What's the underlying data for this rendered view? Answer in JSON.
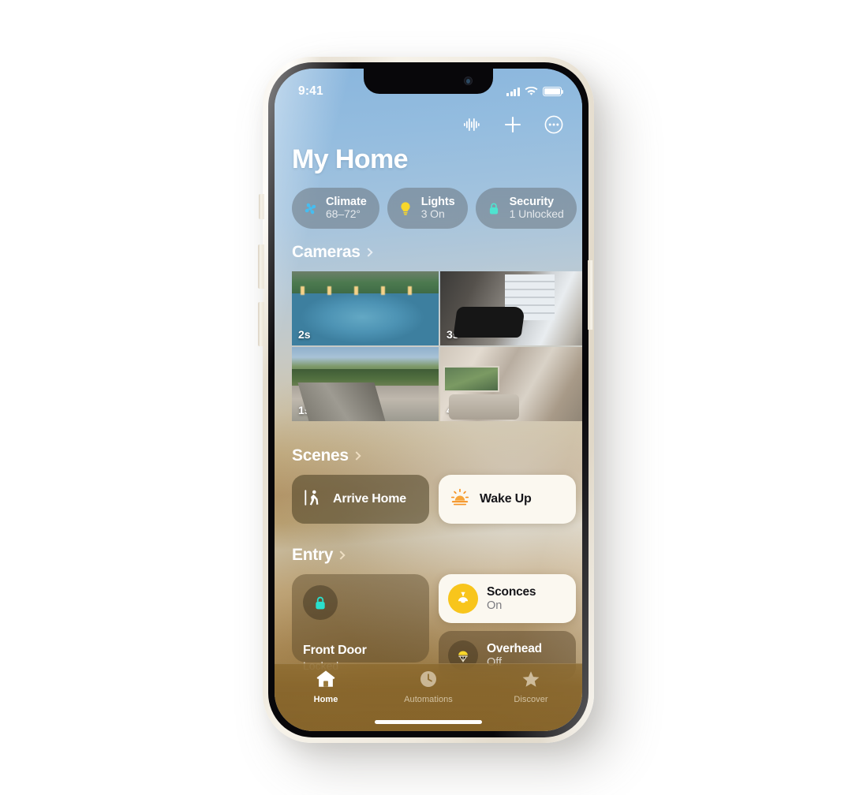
{
  "status_bar": {
    "time": "9:41",
    "cellular_icon": "signal-bars-icon",
    "wifi_icon": "wifi-icon",
    "battery_icon": "battery-full-icon"
  },
  "header": {
    "title": "My Home",
    "actions": [
      {
        "name": "siri-waveform-icon",
        "label": "Siri"
      },
      {
        "name": "add-icon",
        "label": "Add"
      },
      {
        "name": "more-options-icon",
        "label": "More"
      }
    ]
  },
  "status_pills": [
    {
      "icon": "fan-icon",
      "title": "Climate",
      "subtitle": "68–72°",
      "color": "#46bdf0"
    },
    {
      "icon": "bulb-icon",
      "title": "Lights",
      "subtitle": "3 On",
      "color": "#f8d72b"
    },
    {
      "icon": "lock-icon",
      "title": "Security",
      "subtitle": "1 Unlocked",
      "color": "#4fe3d0"
    }
  ],
  "sections": {
    "cameras": {
      "title": "Cameras",
      "chevron": "chevron-right-icon"
    },
    "scenes": {
      "title": "Scenes",
      "chevron": "chevron-right-icon"
    },
    "entry": {
      "title": "Entry",
      "chevron": "chevron-right-icon"
    }
  },
  "cameras": [
    {
      "name": "camera-pool",
      "timestamp": "2s"
    },
    {
      "name": "camera-garage",
      "timestamp": "3s"
    },
    {
      "name": "camera-driveway",
      "timestamp": "1s"
    },
    {
      "name": "camera-livingroom",
      "timestamp": "4s"
    }
  ],
  "scenes": [
    {
      "name": "scene-arrive-home",
      "label": "Arrive Home",
      "icon": "person-walking-door-icon",
      "state": "off"
    },
    {
      "name": "scene-wake-up",
      "label": "Wake Up",
      "icon": "sunrise-icon",
      "state": "on"
    }
  ],
  "entry": {
    "front_door": {
      "label": "Front Door",
      "subtitle": "Locked",
      "icon": "lock-icon"
    },
    "accessories": [
      {
        "name": "sconces",
        "title": "Sconces",
        "state": "On",
        "icon": "sconce-lamp-icon"
      },
      {
        "name": "overhead",
        "title": "Overhead",
        "state": "Off",
        "icon": "ceiling-light-icon"
      }
    ]
  },
  "tab_bar": [
    {
      "name": "tab-home",
      "label": "Home",
      "icon": "house-icon",
      "active": true
    },
    {
      "name": "tab-automations",
      "label": "Automations",
      "icon": "clock-icon",
      "active": false
    },
    {
      "name": "tab-discover",
      "label": "Discover",
      "icon": "star-icon",
      "active": false
    }
  ],
  "colors": {
    "accent_yellow": "#f8c51c",
    "accent_orange": "#f59324",
    "accent_teal": "#4fe3d0",
    "accent_blue": "#46bdf0",
    "tile_on_bg": "#fbf8f0",
    "page_bg": "#ffffff"
  }
}
